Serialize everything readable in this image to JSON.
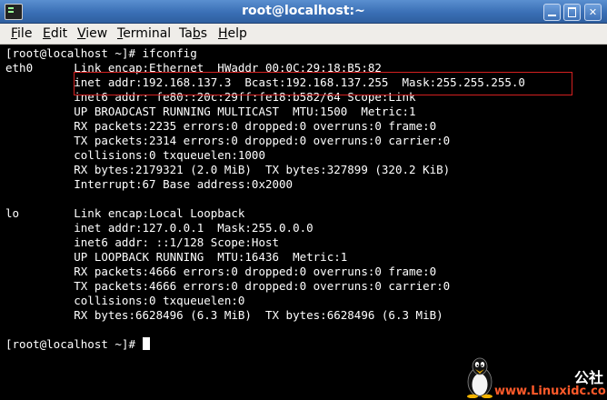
{
  "window": {
    "title": "root@localhost:~"
  },
  "menu": [
    {
      "pre": "",
      "ul": "F",
      "post": "ile"
    },
    {
      "pre": "",
      "ul": "E",
      "post": "dit"
    },
    {
      "pre": "",
      "ul": "V",
      "post": "iew"
    },
    {
      "pre": "",
      "ul": "T",
      "post": "erminal"
    },
    {
      "pre": "Ta",
      "ul": "b",
      "post": "s"
    },
    {
      "pre": "",
      "ul": "H",
      "post": "elp"
    }
  ],
  "terminal": {
    "lines": [
      "[root@localhost ~]# ifconfig",
      "eth0      Link encap:Ethernet  HWaddr 00:0C:29:18:B5:82",
      "          inet addr:192.168.137.3  Bcast:192.168.137.255  Mask:255.255.255.0",
      "          inet6 addr: fe80::20c:29ff:fe18:b582/64 Scope:Link",
      "          UP BROADCAST RUNNING MULTICAST  MTU:1500  Metric:1",
      "          RX packets:2235 errors:0 dropped:0 overruns:0 frame:0",
      "          TX packets:2314 errors:0 dropped:0 overruns:0 carrier:0",
      "          collisions:0 txqueuelen:1000",
      "          RX bytes:2179321 (2.0 MiB)  TX bytes:327899 (320.2 KiB)",
      "          Interrupt:67 Base address:0x2000",
      "",
      "lo        Link encap:Local Loopback",
      "          inet addr:127.0.0.1  Mask:255.0.0.0",
      "          inet6 addr: ::1/128 Scope:Host",
      "          UP LOOPBACK RUNNING  MTU:16436  Metric:1",
      "          RX packets:4666 errors:0 dropped:0 overruns:0 frame:0",
      "          TX packets:4666 errors:0 dropped:0 overruns:0 carrier:0",
      "          collisions:0 txqueuelen:0",
      "          RX bytes:6628496 (6.3 MiB)  TX bytes:6628496 (6.3 MiB)",
      "",
      "[root@localhost ~]# "
    ]
  },
  "watermark": {
    "cn": "公社",
    "url": "www.Linuxidc.com"
  },
  "colors": {
    "titlebar": "#3a6fb5",
    "highlight": "#d42020",
    "watermark": "#ff5a2a"
  }
}
